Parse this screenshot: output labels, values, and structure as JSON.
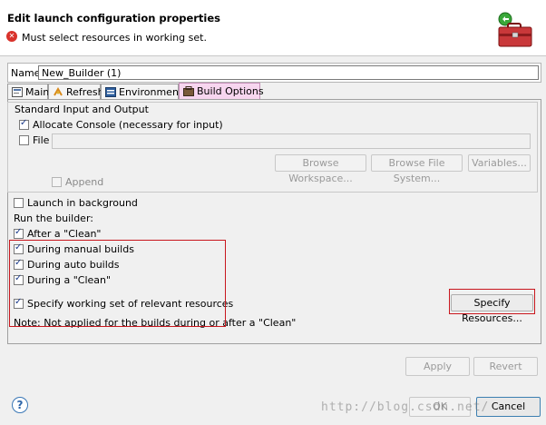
{
  "dialog": {
    "title": "Edit launch configuration properties",
    "message": "Must select resources in working set."
  },
  "name_field": {
    "label": "Name:",
    "value": "New_Builder (1)"
  },
  "tabs": [
    {
      "label": "Main",
      "active": false
    },
    {
      "label": "Refresh",
      "active": false
    },
    {
      "label": "Environment",
      "active": false
    },
    {
      "label": "Build Options",
      "active": true
    }
  ],
  "io_group": {
    "label": "Standard Input and Output",
    "allocate_console": {
      "label": "Allocate Console (necessary for input)",
      "checked": true
    },
    "file": {
      "label": "File",
      "checked": false,
      "value": ""
    },
    "browse_workspace": "Browse Workspace...",
    "browse_file_system": "Browse File System...",
    "variables": "Variables...",
    "append": {
      "label": "Append",
      "checked": false
    }
  },
  "launch_background": {
    "label": "Launch in background",
    "checked": false
  },
  "run_builder": {
    "label": "Run the builder:",
    "after_clean": {
      "label": "After a \"Clean\"",
      "checked": true
    },
    "manual_builds": {
      "label": "During manual builds",
      "checked": true
    },
    "auto_builds": {
      "label": "During auto builds",
      "checked": true
    },
    "during_clean": {
      "label": "During a \"Clean\"",
      "checked": true
    },
    "working_set": {
      "label": "Specify working set of relevant resources",
      "checked": true
    }
  },
  "specify_resources": "Specify Resources...",
  "note": "Note: Not applied for the builds during or after a \"Clean\"",
  "apply": "Apply",
  "revert": "Revert",
  "ok": "OK",
  "cancel": "Cancel",
  "watermark": "http://blog.csdn.net/",
  "colors": {
    "highlight_box": "#c8161d",
    "active_tab": "#f7d6ef",
    "error": "#d9322b"
  }
}
